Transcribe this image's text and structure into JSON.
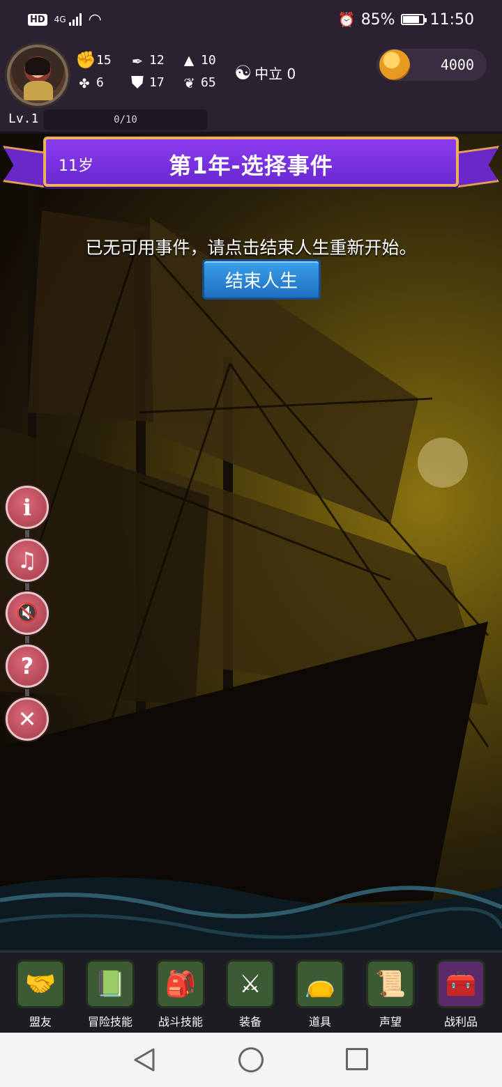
{
  "status_bar": {
    "network": "HD",
    "signal_type": "4G",
    "battery": "85%",
    "battery_level": 0.85,
    "time": "11:50"
  },
  "hud": {
    "stats": [
      {
        "icon": "fist-icon",
        "value": "15"
      },
      {
        "icon": "clover-icon",
        "value": "6"
      },
      {
        "icon": "quill-icon",
        "value": "12"
      },
      {
        "icon": "armor-icon",
        "value": "17"
      },
      {
        "icon": "wizard-hat-icon",
        "value": "10"
      },
      {
        "icon": "lotus-icon",
        "value": "65"
      }
    ],
    "alignment": "中立 0",
    "gold": "4000",
    "level": "Lv.1",
    "xp": "0/10"
  },
  "banner": {
    "age": "11岁",
    "title": "第1年-选择事件"
  },
  "message": "已无可用事件，请点击结束人生重新开始。",
  "end_button": "结束人生",
  "side_buttons": [
    {
      "name": "info-button",
      "icon": "info-icon",
      "glyph": "i"
    },
    {
      "name": "music-toggle-button",
      "icon": "music-off-icon",
      "glyph": "♫"
    },
    {
      "name": "sound-toggle-button",
      "icon": "sound-off-icon",
      "glyph": "🔇"
    },
    {
      "name": "help-button",
      "icon": "help-icon",
      "glyph": "?"
    },
    {
      "name": "close-button",
      "icon": "close-icon",
      "glyph": "✕"
    }
  ],
  "bottom_nav": [
    {
      "label": "盟友",
      "icon": "handshake-icon",
      "glyph": "🤝"
    },
    {
      "label": "冒险技能",
      "icon": "book-icon",
      "glyph": "📗"
    },
    {
      "label": "战斗技能",
      "icon": "backpack-icon",
      "glyph": "🎒"
    },
    {
      "label": "装备",
      "icon": "swords-icon",
      "glyph": "⚔"
    },
    {
      "label": "道具",
      "icon": "pouch-icon",
      "glyph": "👝"
    },
    {
      "label": "声望",
      "icon": "scroll-icon",
      "glyph": "📜"
    },
    {
      "label": "战利品",
      "icon": "treasure-chest-icon",
      "glyph": "🧰"
    }
  ]
}
